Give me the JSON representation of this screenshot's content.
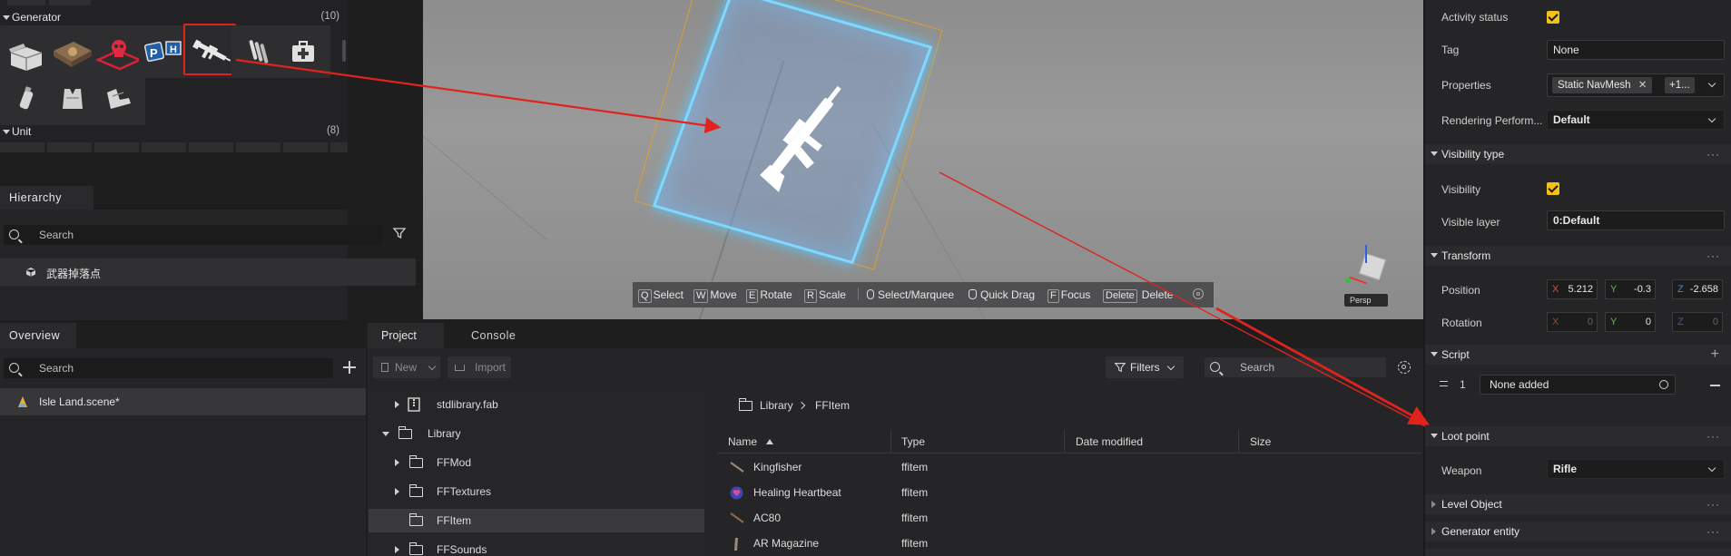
{
  "left_top": {
    "generator": {
      "label": "Generator",
      "count": "(10)"
    },
    "unit": {
      "label": "Unit",
      "count": "(8)"
    },
    "assets": [
      "crate-icon",
      "supply-box-icon",
      "skull-trap-icon",
      "parking-sign-icon",
      "rifle-icon",
      "ammo-icon",
      "medkit-icon",
      "grenade-icon",
      "vest-icon",
      "boots-icon"
    ]
  },
  "hierarchy": {
    "tab": "Hierarchy",
    "search_placeholder": "Search",
    "item": "武器掉落点"
  },
  "overview": {
    "tab": "Overview",
    "search_placeholder": "Search",
    "scene": "Isle Land.scene*"
  },
  "project": {
    "tabs": [
      "Project",
      "Console"
    ],
    "new_label": "New",
    "import_label": "Import",
    "filters_label": "Filters",
    "search_placeholder": "Search",
    "tree": [
      "stdlibrary.fab",
      "Library",
      "FFMod",
      "FFTextures",
      "FFItem",
      "FFSounds"
    ],
    "breadcrumb": [
      "Library",
      "FFItem"
    ],
    "columns": [
      "Name",
      "Type",
      "Date modified",
      "Size"
    ],
    "files": [
      {
        "name": "Kingfisher",
        "type": "ffitem",
        "icon": "rifle-icon"
      },
      {
        "name": "Healing Heartbeat",
        "type": "ffitem",
        "icon": "heart-orb-icon"
      },
      {
        "name": "AC80",
        "type": "ffitem",
        "icon": "rifle-icon"
      },
      {
        "name": "AR Magazine",
        "type": "ffitem",
        "icon": "magazine-icon"
      }
    ]
  },
  "viewport": {
    "tools": [
      {
        "key": "Q",
        "label": "Select"
      },
      {
        "key": "W",
        "label": "Move"
      },
      {
        "key": "E",
        "label": "Rotate"
      },
      {
        "key": "R",
        "label": "Scale"
      },
      {
        "key": "",
        "label": "Select/Marquee"
      },
      {
        "key": "",
        "label": "Quick Drag"
      },
      {
        "key": "F",
        "label": "Focus"
      },
      {
        "key": "Delete",
        "label": "Delete"
      }
    ],
    "persp_label": "Persp"
  },
  "inspector": {
    "activity_status": "Activity status",
    "tag_label": "Tag",
    "tag_value": "None",
    "properties_label": "Properties",
    "properties_chip": "Static NavMesh",
    "properties_more": "+1...",
    "rendering_label": "Rendering Perform...",
    "rendering_value": "Default",
    "visibility_type": "Visibility type",
    "visibility_label": "Visibility",
    "visible_layer_label": "Visible layer",
    "visible_layer_value": "0:Default",
    "transform": "Transform",
    "position_label": "Position",
    "position": {
      "x": "5.212",
      "y": "-0.3",
      "z": "-2.658"
    },
    "rotation_label": "Rotation",
    "rotation": {
      "x": "0",
      "y": "0",
      "z": "0"
    },
    "script": "Script",
    "script_index": "1",
    "script_value": "None added",
    "loot_point": "Loot point",
    "weapon_label": "Weapon",
    "weapon_value": "Rifle",
    "level_object": "Level Object",
    "generator_entity": "Generator entity"
  },
  "colors": {
    "accent_yellow": "#f3c21a",
    "annotation_red": "#e0231d",
    "selection_cyan": "#7fd8ff"
  }
}
